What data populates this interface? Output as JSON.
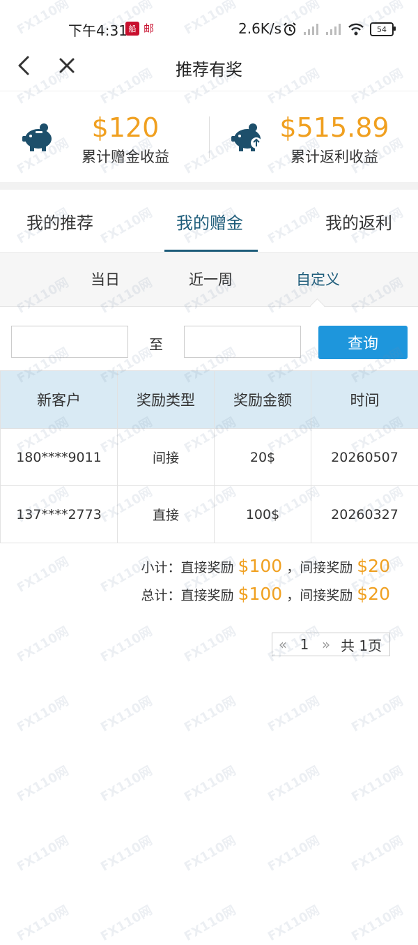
{
  "status_bar": {
    "time": "下午4:31",
    "app_badge": "船",
    "mail_glyph": "邮",
    "network_speed": "2.6K/s",
    "battery": "54"
  },
  "nav": {
    "title": "推荐有奖"
  },
  "summary": {
    "gift": {
      "value": "$120",
      "label": "累计赠金收益"
    },
    "rebate": {
      "value": "$515.89",
      "label": "累计返利收益"
    }
  },
  "tabs": [
    {
      "label": "我的推荐",
      "active": false
    },
    {
      "label": "我的赠金",
      "active": true
    },
    {
      "label": "我的返利",
      "active": false
    }
  ],
  "filters": [
    {
      "label": "当日",
      "active": false
    },
    {
      "label": "近一周",
      "active": false
    },
    {
      "label": "自定义",
      "active": true
    }
  ],
  "date_range": {
    "start_value": "",
    "separator": "至",
    "end_value": "",
    "query_label": "查询"
  },
  "table": {
    "headers": [
      "新客户",
      "奖励类型",
      "奖励金额",
      "时间"
    ],
    "rows": [
      [
        "180****9011",
        "间接",
        "20$",
        "20260507"
      ],
      [
        "137****2773",
        "直接",
        "100$",
        "20260327"
      ]
    ]
  },
  "totals": {
    "subtotal": {
      "label": "小计：直接奖励",
      "direct": "$100",
      "sep": "，间接奖励",
      "indirect": "$20"
    },
    "total": {
      "label": "总计：直接奖励",
      "direct": "$100",
      "sep": "，间接奖励",
      "indirect": "$20"
    }
  },
  "pagination": {
    "prev": "«",
    "page": "1",
    "next": "»",
    "total": "共 1页"
  },
  "watermark_text": "FX110网",
  "colors": {
    "accent": "#1d5c7a",
    "amount": "#f0a020",
    "button": "#1e96dc",
    "table_header": "#d9eaf4"
  }
}
